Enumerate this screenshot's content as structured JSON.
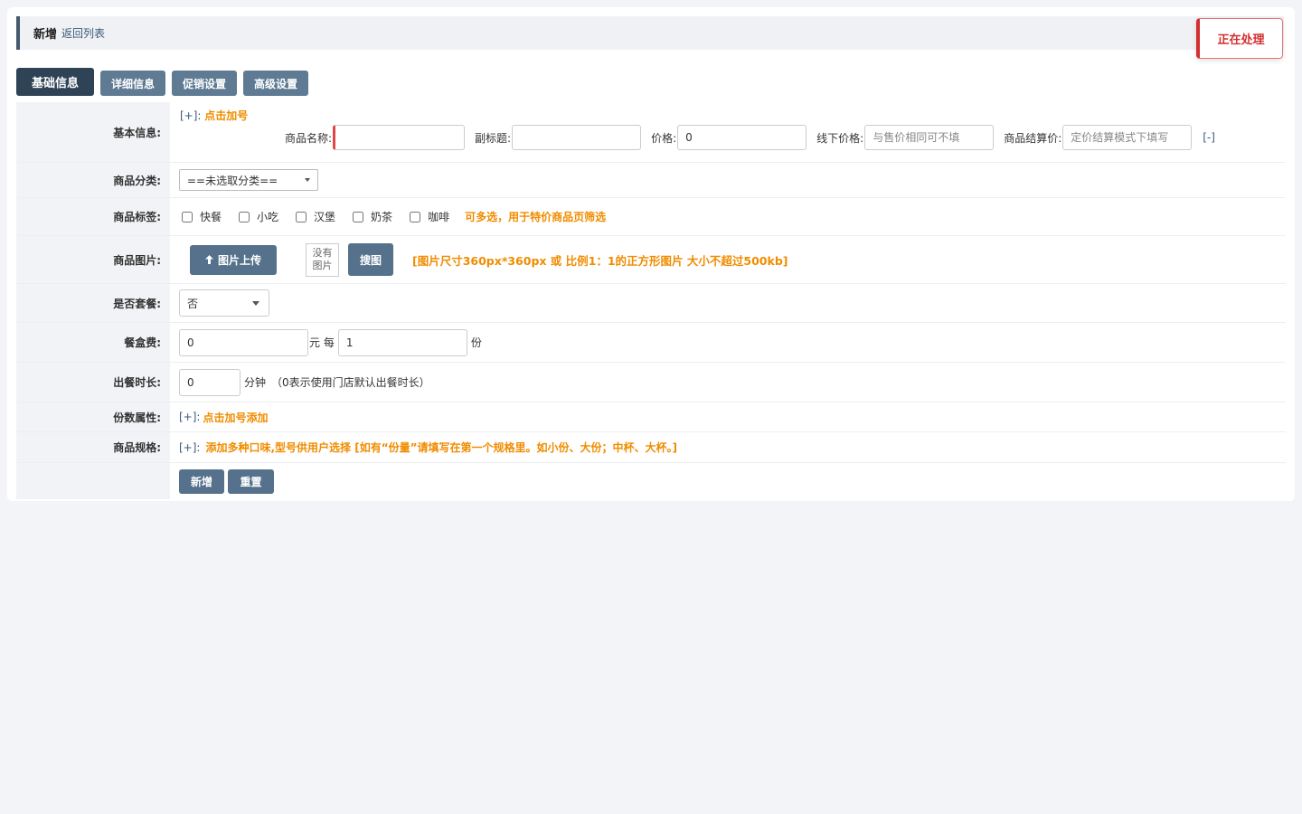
{
  "header": {
    "title": "新增",
    "back_link": "返回列表"
  },
  "toast": {
    "text": "正在处理"
  },
  "tabs": [
    {
      "label": "基础信息",
      "active": true
    },
    {
      "label": "详细信息",
      "active": false
    },
    {
      "label": "促销设置",
      "active": false
    },
    {
      "label": "高级设置",
      "active": false
    }
  ],
  "basic_info": {
    "label": "基本信息:",
    "add_prefix": "[+]:",
    "add_text": "点击加号",
    "name_label": "商品名称:",
    "name_value": "",
    "subtitle_label": "副标题:",
    "subtitle_value": "",
    "price_label": "价格:",
    "price_value": "0",
    "offline_label": "线下价格:",
    "offline_placeholder": "与售价相同可不填",
    "settle_label": "商品结算价:",
    "settle_placeholder": "定价结算模式下填写",
    "remove": "[-]"
  },
  "category": {
    "label": "商品分类:",
    "selected": "==未选取分类=="
  },
  "tags": {
    "label": "商品标签:",
    "options": [
      "快餐",
      "小吃",
      "汉堡",
      "奶茶",
      "咖啡"
    ],
    "hint": "可多选，用于特价商品页筛选"
  },
  "image": {
    "label": "商品图片:",
    "upload": "图片上传",
    "upload_icon": "arrow-up-icon",
    "no_image": "没有\n图片",
    "search": "搜图",
    "hint": "[图片尺寸360px*360px 或 比例1：1的正方形图片 大小不超过500kb]"
  },
  "combo": {
    "label": "是否套餐:",
    "selected": "否"
  },
  "box_fee": {
    "label": "餐盒费:",
    "value": "0",
    "unit": "元 每",
    "per_value": "1",
    "per_unit": "份"
  },
  "prep_time": {
    "label": "出餐时长:",
    "value": "0",
    "unit": "分钟",
    "hint": "（0表示使用门店默认出餐时长）"
  },
  "portions": {
    "label": "份数属性:",
    "add_prefix": "[+]:",
    "add_text": "点击加号添加"
  },
  "specs": {
    "label": "商品规格:",
    "add_prefix": "[+]:",
    "add_text": "添加多种口味,型号供用户选择 [如有“份量”请填写在第一个规格里。如小份、大份；中杯、大杯。]"
  },
  "actions": {
    "submit": "新增",
    "reset": "重置"
  }
}
